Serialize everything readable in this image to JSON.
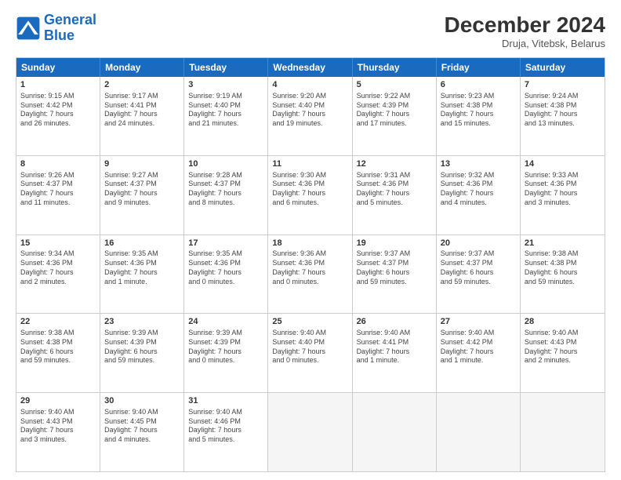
{
  "header": {
    "logo_line1": "General",
    "logo_line2": "Blue",
    "month": "December 2024",
    "location": "Druja, Vitebsk, Belarus"
  },
  "days_of_week": [
    "Sunday",
    "Monday",
    "Tuesday",
    "Wednesday",
    "Thursday",
    "Friday",
    "Saturday"
  ],
  "weeks": [
    [
      {
        "day": "1",
        "lines": [
          "Sunrise: 9:15 AM",
          "Sunset: 4:42 PM",
          "Daylight: 7 hours",
          "and 26 minutes."
        ]
      },
      {
        "day": "2",
        "lines": [
          "Sunrise: 9:17 AM",
          "Sunset: 4:41 PM",
          "Daylight: 7 hours",
          "and 24 minutes."
        ]
      },
      {
        "day": "3",
        "lines": [
          "Sunrise: 9:19 AM",
          "Sunset: 4:40 PM",
          "Daylight: 7 hours",
          "and 21 minutes."
        ]
      },
      {
        "day": "4",
        "lines": [
          "Sunrise: 9:20 AM",
          "Sunset: 4:40 PM",
          "Daylight: 7 hours",
          "and 19 minutes."
        ]
      },
      {
        "day": "5",
        "lines": [
          "Sunrise: 9:22 AM",
          "Sunset: 4:39 PM",
          "Daylight: 7 hours",
          "and 17 minutes."
        ]
      },
      {
        "day": "6",
        "lines": [
          "Sunrise: 9:23 AM",
          "Sunset: 4:38 PM",
          "Daylight: 7 hours",
          "and 15 minutes."
        ]
      },
      {
        "day": "7",
        "lines": [
          "Sunrise: 9:24 AM",
          "Sunset: 4:38 PM",
          "Daylight: 7 hours",
          "and 13 minutes."
        ]
      }
    ],
    [
      {
        "day": "8",
        "lines": [
          "Sunrise: 9:26 AM",
          "Sunset: 4:37 PM",
          "Daylight: 7 hours",
          "and 11 minutes."
        ]
      },
      {
        "day": "9",
        "lines": [
          "Sunrise: 9:27 AM",
          "Sunset: 4:37 PM",
          "Daylight: 7 hours",
          "and 9 minutes."
        ]
      },
      {
        "day": "10",
        "lines": [
          "Sunrise: 9:28 AM",
          "Sunset: 4:37 PM",
          "Daylight: 7 hours",
          "and 8 minutes."
        ]
      },
      {
        "day": "11",
        "lines": [
          "Sunrise: 9:30 AM",
          "Sunset: 4:36 PM",
          "Daylight: 7 hours",
          "and 6 minutes."
        ]
      },
      {
        "day": "12",
        "lines": [
          "Sunrise: 9:31 AM",
          "Sunset: 4:36 PM",
          "Daylight: 7 hours",
          "and 5 minutes."
        ]
      },
      {
        "day": "13",
        "lines": [
          "Sunrise: 9:32 AM",
          "Sunset: 4:36 PM",
          "Daylight: 7 hours",
          "and 4 minutes."
        ]
      },
      {
        "day": "14",
        "lines": [
          "Sunrise: 9:33 AM",
          "Sunset: 4:36 PM",
          "Daylight: 7 hours",
          "and 3 minutes."
        ]
      }
    ],
    [
      {
        "day": "15",
        "lines": [
          "Sunrise: 9:34 AM",
          "Sunset: 4:36 PM",
          "Daylight: 7 hours",
          "and 2 minutes."
        ]
      },
      {
        "day": "16",
        "lines": [
          "Sunrise: 9:35 AM",
          "Sunset: 4:36 PM",
          "Daylight: 7 hours",
          "and 1 minute."
        ]
      },
      {
        "day": "17",
        "lines": [
          "Sunrise: 9:35 AM",
          "Sunset: 4:36 PM",
          "Daylight: 7 hours",
          "and 0 minutes."
        ]
      },
      {
        "day": "18",
        "lines": [
          "Sunrise: 9:36 AM",
          "Sunset: 4:36 PM",
          "Daylight: 7 hours",
          "and 0 minutes."
        ]
      },
      {
        "day": "19",
        "lines": [
          "Sunrise: 9:37 AM",
          "Sunset: 4:37 PM",
          "Daylight: 6 hours",
          "and 59 minutes."
        ]
      },
      {
        "day": "20",
        "lines": [
          "Sunrise: 9:37 AM",
          "Sunset: 4:37 PM",
          "Daylight: 6 hours",
          "and 59 minutes."
        ]
      },
      {
        "day": "21",
        "lines": [
          "Sunrise: 9:38 AM",
          "Sunset: 4:38 PM",
          "Daylight: 6 hours",
          "and 59 minutes."
        ]
      }
    ],
    [
      {
        "day": "22",
        "lines": [
          "Sunrise: 9:38 AM",
          "Sunset: 4:38 PM",
          "Daylight: 6 hours",
          "and 59 minutes."
        ]
      },
      {
        "day": "23",
        "lines": [
          "Sunrise: 9:39 AM",
          "Sunset: 4:39 PM",
          "Daylight: 6 hours",
          "and 59 minutes."
        ]
      },
      {
        "day": "24",
        "lines": [
          "Sunrise: 9:39 AM",
          "Sunset: 4:39 PM",
          "Daylight: 7 hours",
          "and 0 minutes."
        ]
      },
      {
        "day": "25",
        "lines": [
          "Sunrise: 9:40 AM",
          "Sunset: 4:40 PM",
          "Daylight: 7 hours",
          "and 0 minutes."
        ]
      },
      {
        "day": "26",
        "lines": [
          "Sunrise: 9:40 AM",
          "Sunset: 4:41 PM",
          "Daylight: 7 hours",
          "and 1 minute."
        ]
      },
      {
        "day": "27",
        "lines": [
          "Sunrise: 9:40 AM",
          "Sunset: 4:42 PM",
          "Daylight: 7 hours",
          "and 1 minute."
        ]
      },
      {
        "day": "28",
        "lines": [
          "Sunrise: 9:40 AM",
          "Sunset: 4:43 PM",
          "Daylight: 7 hours",
          "and 2 minutes."
        ]
      }
    ],
    [
      {
        "day": "29",
        "lines": [
          "Sunrise: 9:40 AM",
          "Sunset: 4:43 PM",
          "Daylight: 7 hours",
          "and 3 minutes."
        ]
      },
      {
        "day": "30",
        "lines": [
          "Sunrise: 9:40 AM",
          "Sunset: 4:45 PM",
          "Daylight: 7 hours",
          "and 4 minutes."
        ]
      },
      {
        "day": "31",
        "lines": [
          "Sunrise: 9:40 AM",
          "Sunset: 4:46 PM",
          "Daylight: 7 hours",
          "and 5 minutes."
        ]
      },
      {
        "day": "",
        "lines": []
      },
      {
        "day": "",
        "lines": []
      },
      {
        "day": "",
        "lines": []
      },
      {
        "day": "",
        "lines": []
      }
    ]
  ]
}
